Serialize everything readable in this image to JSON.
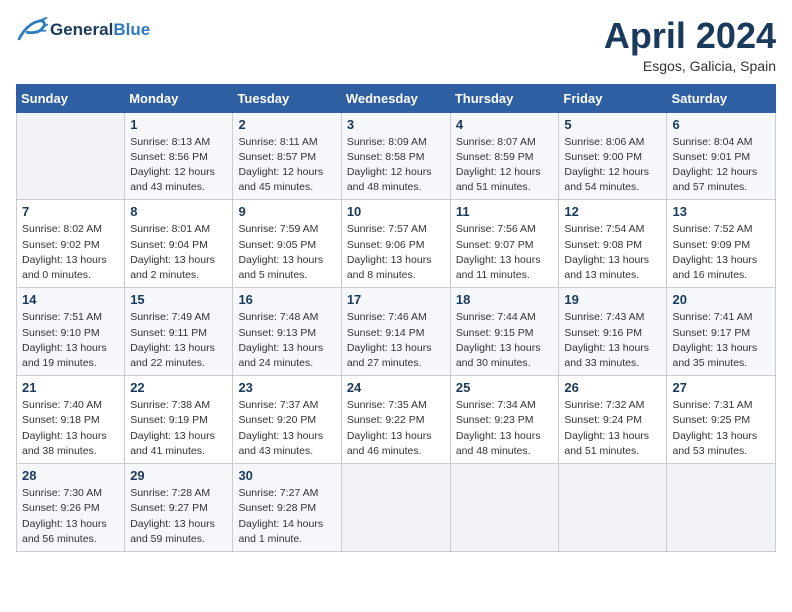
{
  "header": {
    "logo_line1": "General",
    "logo_line2": "Blue",
    "month_title": "April 2024",
    "subtitle": "Esgos, Galicia, Spain"
  },
  "days_of_week": [
    "Sunday",
    "Monday",
    "Tuesday",
    "Wednesday",
    "Thursday",
    "Friday",
    "Saturday"
  ],
  "weeks": [
    [
      {
        "num": "",
        "info": ""
      },
      {
        "num": "1",
        "info": "Sunrise: 8:13 AM\nSunset: 8:56 PM\nDaylight: 12 hours\nand 43 minutes."
      },
      {
        "num": "2",
        "info": "Sunrise: 8:11 AM\nSunset: 8:57 PM\nDaylight: 12 hours\nand 45 minutes."
      },
      {
        "num": "3",
        "info": "Sunrise: 8:09 AM\nSunset: 8:58 PM\nDaylight: 12 hours\nand 48 minutes."
      },
      {
        "num": "4",
        "info": "Sunrise: 8:07 AM\nSunset: 8:59 PM\nDaylight: 12 hours\nand 51 minutes."
      },
      {
        "num": "5",
        "info": "Sunrise: 8:06 AM\nSunset: 9:00 PM\nDaylight: 12 hours\nand 54 minutes."
      },
      {
        "num": "6",
        "info": "Sunrise: 8:04 AM\nSunset: 9:01 PM\nDaylight: 12 hours\nand 57 minutes."
      }
    ],
    [
      {
        "num": "7",
        "info": "Sunrise: 8:02 AM\nSunset: 9:02 PM\nDaylight: 13 hours\nand 0 minutes."
      },
      {
        "num": "8",
        "info": "Sunrise: 8:01 AM\nSunset: 9:04 PM\nDaylight: 13 hours\nand 2 minutes."
      },
      {
        "num": "9",
        "info": "Sunrise: 7:59 AM\nSunset: 9:05 PM\nDaylight: 13 hours\nand 5 minutes."
      },
      {
        "num": "10",
        "info": "Sunrise: 7:57 AM\nSunset: 9:06 PM\nDaylight: 13 hours\nand 8 minutes."
      },
      {
        "num": "11",
        "info": "Sunrise: 7:56 AM\nSunset: 9:07 PM\nDaylight: 13 hours\nand 11 minutes."
      },
      {
        "num": "12",
        "info": "Sunrise: 7:54 AM\nSunset: 9:08 PM\nDaylight: 13 hours\nand 13 minutes."
      },
      {
        "num": "13",
        "info": "Sunrise: 7:52 AM\nSunset: 9:09 PM\nDaylight: 13 hours\nand 16 minutes."
      }
    ],
    [
      {
        "num": "14",
        "info": "Sunrise: 7:51 AM\nSunset: 9:10 PM\nDaylight: 13 hours\nand 19 minutes."
      },
      {
        "num": "15",
        "info": "Sunrise: 7:49 AM\nSunset: 9:11 PM\nDaylight: 13 hours\nand 22 minutes."
      },
      {
        "num": "16",
        "info": "Sunrise: 7:48 AM\nSunset: 9:13 PM\nDaylight: 13 hours\nand 24 minutes."
      },
      {
        "num": "17",
        "info": "Sunrise: 7:46 AM\nSunset: 9:14 PM\nDaylight: 13 hours\nand 27 minutes."
      },
      {
        "num": "18",
        "info": "Sunrise: 7:44 AM\nSunset: 9:15 PM\nDaylight: 13 hours\nand 30 minutes."
      },
      {
        "num": "19",
        "info": "Sunrise: 7:43 AM\nSunset: 9:16 PM\nDaylight: 13 hours\nand 33 minutes."
      },
      {
        "num": "20",
        "info": "Sunrise: 7:41 AM\nSunset: 9:17 PM\nDaylight: 13 hours\nand 35 minutes."
      }
    ],
    [
      {
        "num": "21",
        "info": "Sunrise: 7:40 AM\nSunset: 9:18 PM\nDaylight: 13 hours\nand 38 minutes."
      },
      {
        "num": "22",
        "info": "Sunrise: 7:38 AM\nSunset: 9:19 PM\nDaylight: 13 hours\nand 41 minutes."
      },
      {
        "num": "23",
        "info": "Sunrise: 7:37 AM\nSunset: 9:20 PM\nDaylight: 13 hours\nand 43 minutes."
      },
      {
        "num": "24",
        "info": "Sunrise: 7:35 AM\nSunset: 9:22 PM\nDaylight: 13 hours\nand 46 minutes."
      },
      {
        "num": "25",
        "info": "Sunrise: 7:34 AM\nSunset: 9:23 PM\nDaylight: 13 hours\nand 48 minutes."
      },
      {
        "num": "26",
        "info": "Sunrise: 7:32 AM\nSunset: 9:24 PM\nDaylight: 13 hours\nand 51 minutes."
      },
      {
        "num": "27",
        "info": "Sunrise: 7:31 AM\nSunset: 9:25 PM\nDaylight: 13 hours\nand 53 minutes."
      }
    ],
    [
      {
        "num": "28",
        "info": "Sunrise: 7:30 AM\nSunset: 9:26 PM\nDaylight: 13 hours\nand 56 minutes."
      },
      {
        "num": "29",
        "info": "Sunrise: 7:28 AM\nSunset: 9:27 PM\nDaylight: 13 hours\nand 59 minutes."
      },
      {
        "num": "30",
        "info": "Sunrise: 7:27 AM\nSunset: 9:28 PM\nDaylight: 14 hours\nand 1 minute."
      },
      {
        "num": "",
        "info": ""
      },
      {
        "num": "",
        "info": ""
      },
      {
        "num": "",
        "info": ""
      },
      {
        "num": "",
        "info": ""
      }
    ]
  ]
}
